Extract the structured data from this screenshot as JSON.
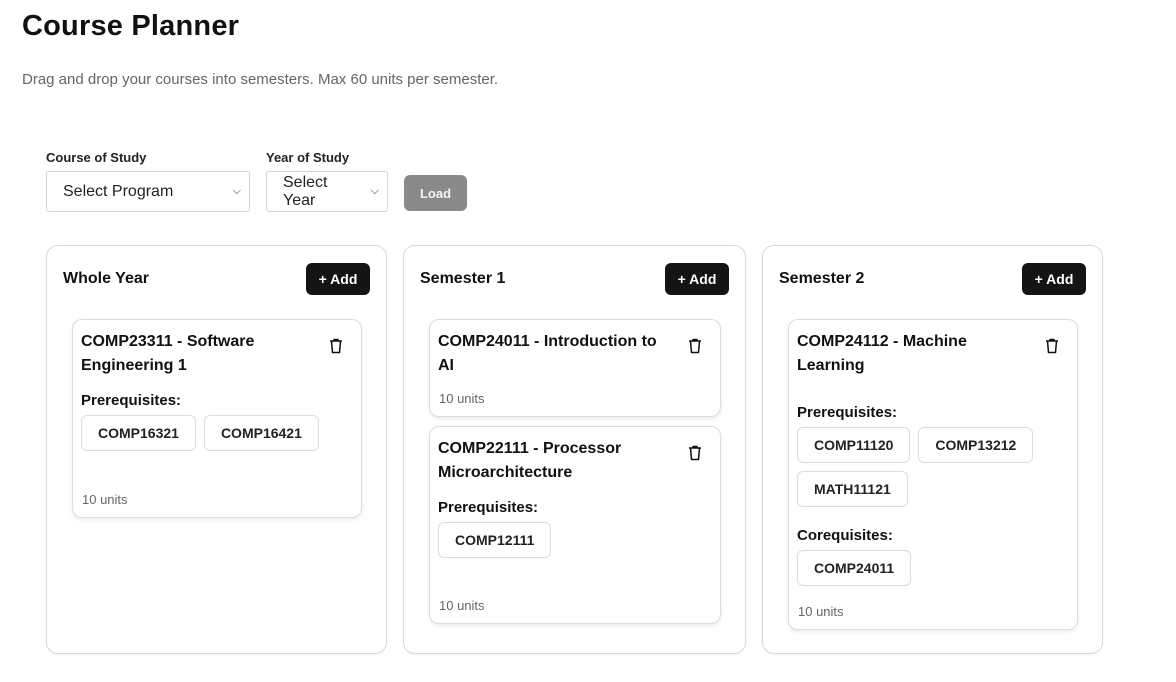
{
  "page": {
    "title": "Course Planner",
    "subtitle": "Drag and drop your courses into semesters. Max 60 units per semester."
  },
  "filters": {
    "program_label": "Course of Study",
    "program_value": "Select Program",
    "year_label": "Year of Study",
    "year_value": "Select Year",
    "load_label": "Load"
  },
  "columns": [
    {
      "title": "Whole Year",
      "add_label": "+ Add",
      "courses": [
        {
          "title": "COMP23311 - Software Engineering 1",
          "prereq_label": "Prerequisites:",
          "prereqs": [
            "COMP16321",
            "COMP16421"
          ],
          "units": "10 units"
        }
      ]
    },
    {
      "title": "Semester 1",
      "add_label": "+ Add",
      "courses": [
        {
          "title": "COMP24011 - Introduction to AI",
          "units": "10 units"
        },
        {
          "title": "COMP22111 - Processor Microarchitecture",
          "prereq_label": "Prerequisites:",
          "prereqs": [
            "COMP12111"
          ],
          "units": "10 units"
        }
      ]
    },
    {
      "title": "Semester 2",
      "add_label": "+ Add",
      "courses": [
        {
          "title": "COMP24112 - Machine Learning",
          "prereq_label": "Prerequisites:",
          "prereqs": [
            "COMP11120",
            "COMP13212",
            "MATH11121"
          ],
          "coreq_label": "Corequisites:",
          "coreqs": [
            "COMP24011"
          ],
          "units": "10 units"
        }
      ]
    }
  ],
  "icons": {
    "delete": "trash-icon",
    "dropdown": "chevron-down-icon"
  },
  "colors": {
    "primary_button": "#141414",
    "disabled_button": "#8a8a8a",
    "muted_text": "#666666",
    "border": "#d9d9d9"
  }
}
